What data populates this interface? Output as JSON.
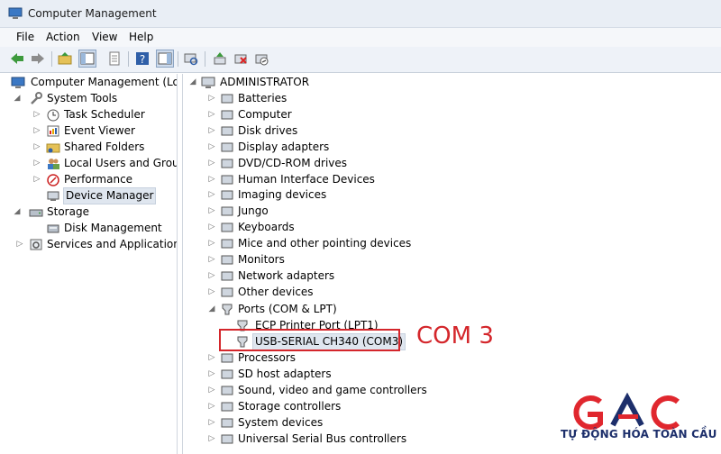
{
  "window": {
    "title": "Computer Management"
  },
  "menu": [
    "File",
    "Action",
    "View",
    "Help"
  ],
  "left_tree": {
    "root": "Computer Management (Local",
    "system_tools": "System Tools",
    "task_scheduler": "Task Scheduler",
    "event_viewer": "Event Viewer",
    "shared_folders": "Shared Folders",
    "local_users": "Local Users and Groups",
    "performance": "Performance",
    "device_manager": "Device Manager",
    "storage": "Storage",
    "disk_management": "Disk Management",
    "services": "Services and Applications"
  },
  "device_tree": {
    "root": "ADMINISTRATOR",
    "categories": [
      "Batteries",
      "Computer",
      "Disk drives",
      "Display adapters",
      "DVD/CD-ROM drives",
      "Human Interface Devices",
      "Imaging devices",
      "Jungo",
      "Keyboards",
      "Mice and other pointing devices",
      "Monitors",
      "Network adapters",
      "Other devices",
      "Ports (COM & LPT)"
    ],
    "ports_children": [
      "ECP Printer Port (LPT1)",
      "USB-SERIAL CH340 (COM3)"
    ],
    "categories_after": [
      "Processors",
      "SD host adapters",
      "Sound, video and game controllers",
      "Storage controllers",
      "System devices",
      "Universal Serial Bus controllers"
    ]
  },
  "annotation": {
    "label": "COM 3",
    "color": "#d4262b"
  },
  "logo": {
    "text": "TỰ ĐỘNG HÓA TOÀN CẦU",
    "red": "#e0272e",
    "navy": "#1d2f6b"
  }
}
